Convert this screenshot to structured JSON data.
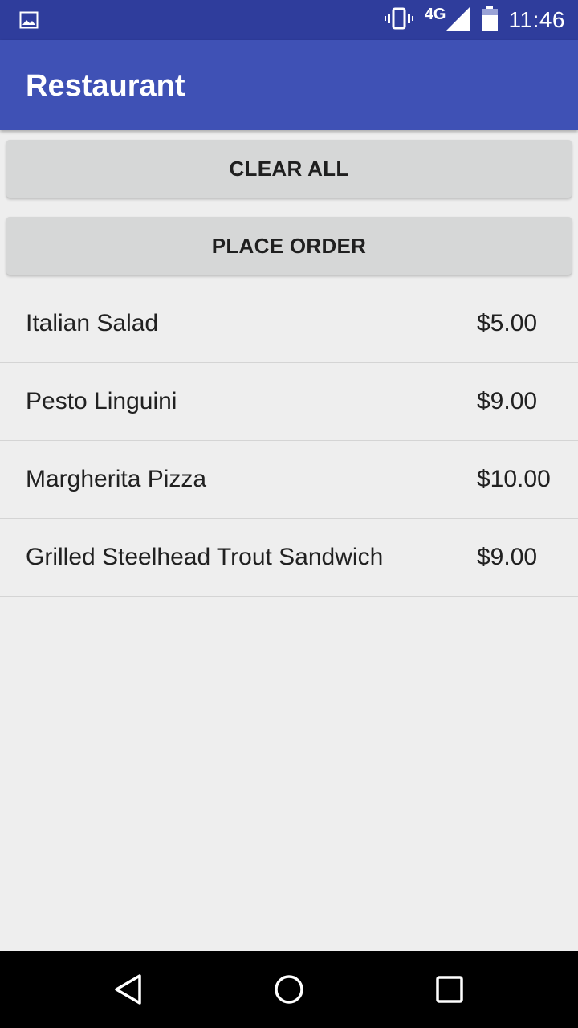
{
  "status_bar": {
    "network": "4G",
    "time": "11:46",
    "icons": [
      "image-icon",
      "vibrate-icon",
      "signal-icon",
      "battery-icon"
    ]
  },
  "app_bar": {
    "title": "Restaurant"
  },
  "buttons": {
    "clear_all": "CLEAR ALL",
    "place_order": "PLACE ORDER"
  },
  "menu_items": [
    {
      "name": "Italian Salad",
      "price": "$5.00"
    },
    {
      "name": "Pesto Linguini",
      "price": "$9.00"
    },
    {
      "name": "Margherita Pizza",
      "price": "$10.00"
    },
    {
      "name": "Grilled Steelhead Trout Sandwich",
      "price": "$9.00"
    }
  ],
  "nav_bar": {
    "icons": [
      "back-icon",
      "home-icon",
      "recents-icon"
    ]
  },
  "colors": {
    "status_bar": "#2f3d9c",
    "app_bar": "#3f51b5",
    "background": "#eeeeee",
    "button": "#d6d7d7"
  }
}
